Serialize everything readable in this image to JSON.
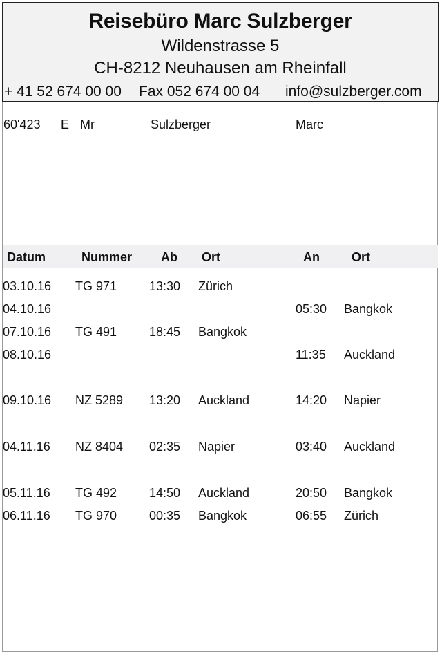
{
  "agency": {
    "name": "Reisebüro Marc Sulzberger",
    "street": "Wildenstrasse  5",
    "city": "CH-8212 Neuhausen am Rheinfall",
    "phone": "+ 41 52 674 00 00",
    "fax": "Fax 052 674 00 04",
    "email": "info@sulzberger.com"
  },
  "customer": {
    "number": "60'423",
    "code": "E",
    "salutation": "Mr",
    "last_name": "Sulzberger",
    "first_name": "Marc"
  },
  "columns": {
    "datum": "Datum",
    "nummer": "Nummer",
    "ab": "Ab",
    "ort_dep": "Ort",
    "an": "An",
    "ort_arr": "Ort"
  },
  "itinerary": [
    {
      "datum": "03.10.16",
      "nummer": "TG 971",
      "ab": "13:30",
      "ort_dep": "Zürich",
      "an": "",
      "ort_arr": ""
    },
    {
      "datum": "04.10.16",
      "nummer": "",
      "ab": "",
      "ort_dep": "",
      "an": "05:30",
      "ort_arr": "Bangkok"
    },
    {
      "datum": "07.10.16",
      "nummer": "TG 491",
      "ab": "18:45",
      "ort_dep": "Bangkok",
      "an": "",
      "ort_arr": ""
    },
    {
      "datum": "08.10.16",
      "nummer": "",
      "ab": "",
      "ort_dep": "",
      "an": "11:35",
      "ort_arr": "Auckland"
    },
    {
      "datum": "09.10.16",
      "nummer": "NZ 5289",
      "ab": "13:20",
      "ort_dep": "Auckland",
      "an": "14:20",
      "ort_arr": "Napier"
    },
    {
      "datum": "04.11.16",
      "nummer": "NZ 8404",
      "ab": "02:35",
      "ort_dep": "Napier",
      "an": "03:40",
      "ort_arr": "Auckland"
    },
    {
      "datum": "05.11.16",
      "nummer": "TG 492",
      "ab": "14:50",
      "ort_dep": "Auckland",
      "an": "20:50",
      "ort_arr": "Bangkok"
    },
    {
      "datum": "06.11.16",
      "nummer": "TG 970",
      "ab": "00:35",
      "ort_dep": "Bangkok",
      "an": "06:55",
      "ort_arr": "Zürich"
    }
  ]
}
